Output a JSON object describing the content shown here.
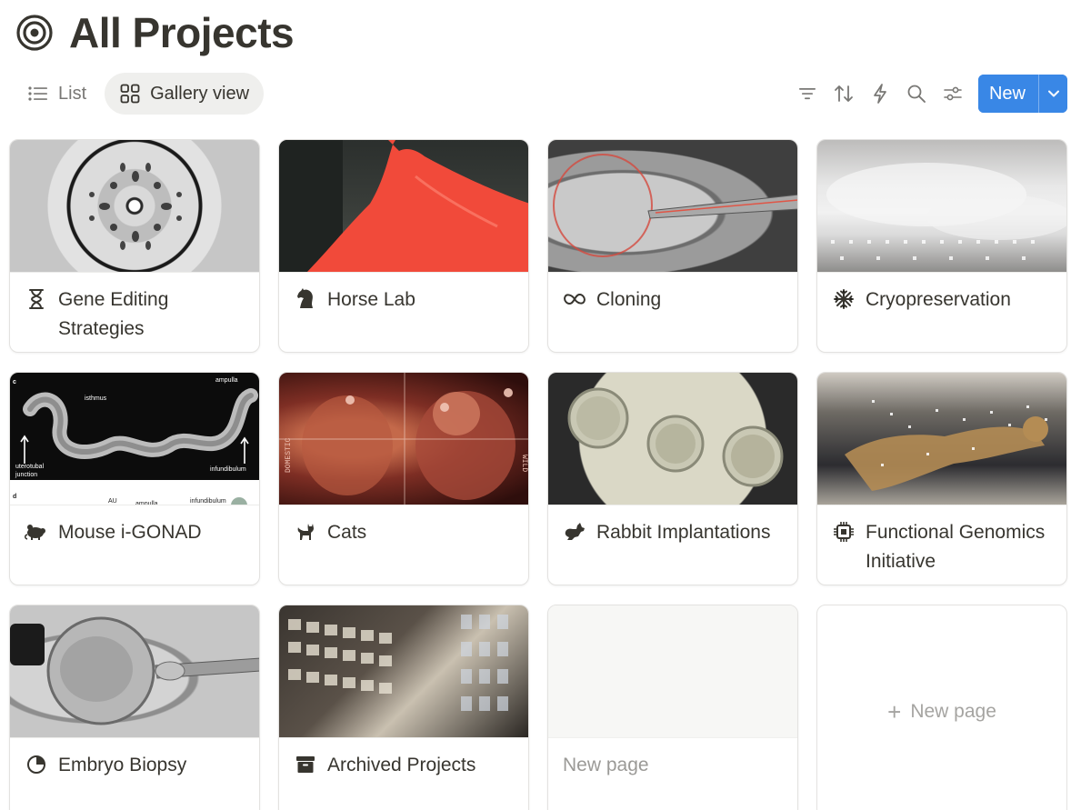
{
  "page": {
    "title": "All Projects",
    "title_icon": "target-icon"
  },
  "views": [
    {
      "label": "List",
      "icon": "list-icon",
      "active": false
    },
    {
      "label": "Gallery view",
      "icon": "gallery-grid-icon",
      "active": true
    }
  ],
  "toolbar": {
    "filter_icon": "filter-icon",
    "sort_icon": "sort-icon",
    "automation_icon": "lightning-icon",
    "search_icon": "search-icon",
    "settings_icon": "sliders-icon",
    "new_label": "New",
    "new_caret_icon": "chevron-down-icon"
  },
  "cards": [
    {
      "title": "Gene Editing Strategies",
      "icon": "hourglass-icon",
      "cover": "diffraction-pattern"
    },
    {
      "title": "Horse Lab",
      "icon": "chess-knight-icon",
      "cover": "red-horse"
    },
    {
      "title": "Cloning",
      "icon": "infinity-icon",
      "cover": "micropipette-oocyte"
    },
    {
      "title": "Cryopreservation",
      "icon": "snowflake-icon",
      "cover": "liquid-nitrogen-vapor"
    },
    {
      "title": "Mouse i-GONAD",
      "icon": "mouse-icon",
      "cover": "oviduct-micrograph"
    },
    {
      "title": "Cats",
      "icon": "cat-icon",
      "cover": "cat-embryos"
    },
    {
      "title": "Rabbit Implantations",
      "icon": "rabbit-icon",
      "cover": "rabbit-embryos"
    },
    {
      "title": "Functional Genomics Initiative",
      "icon": "chip-icon",
      "cover": "cheetah-data"
    },
    {
      "title": "Embryo Biopsy",
      "icon": "half-circle-icon",
      "cover": "blastocyst-biopsy"
    },
    {
      "title": "Archived Projects",
      "icon": "archive-box-icon",
      "cover": "sample-archive"
    }
  ],
  "empty_card": {
    "title": "New page"
  },
  "new_page_card": {
    "label": "New page",
    "icon": "plus-icon"
  },
  "cover_labels": {
    "mouse": {
      "panel_c": "c",
      "panel_d": "d",
      "isthmus": "isthmus",
      "ampulla": "ampulla",
      "junction_1": "uterotubal",
      "junction_2": "junction",
      "infundibulum": "infundibulum",
      "bottom_left": "AU",
      "bottom_mid": "ampulla",
      "bottom_right": "infundibulum"
    },
    "cats": {
      "left": "DOMESTIC",
      "right": "WILD"
    }
  },
  "colors": {
    "accent": "#3987e6",
    "text": "#37352f",
    "muted": "#787774",
    "active_tab_bg": "#efefed",
    "border": "#e3e2e0"
  }
}
